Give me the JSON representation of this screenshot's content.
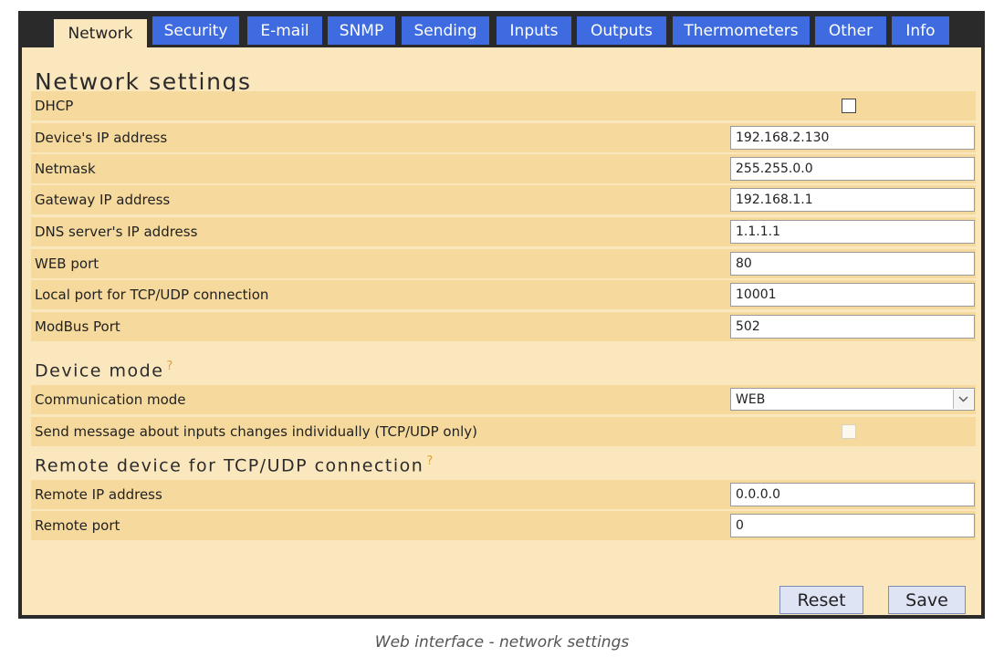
{
  "tabs": [
    "Network",
    "Security",
    "E-mail",
    "SNMP",
    "Sending",
    "Inputs",
    "Outputs",
    "Thermometers",
    "Other",
    "Info"
  ],
  "title": "Network settings",
  "network": {
    "dhcp_label": "DHCP",
    "dhcp_checked": false,
    "ip_label": "Device's IP address",
    "ip_value": "192.168.2.130",
    "netmask_label": "Netmask",
    "netmask_value": "255.255.0.0",
    "gateway_label": "Gateway IP address",
    "gateway_value": "192.168.1.1",
    "dns_label": "DNS server's IP address",
    "dns_value": "1.1.1.1",
    "web_port_label": "WEB port",
    "web_port_value": "80",
    "local_port_label": "Local port for TCP/UDP connection",
    "local_port_value": "10001",
    "modbus_label": "ModBus Port",
    "modbus_value": "502"
  },
  "device_mode": {
    "heading": "Device mode",
    "help": "?",
    "comm_label": "Communication mode",
    "comm_value": "WEB",
    "send_individually_label": "Send message about inputs changes individually (TCP/UDP only)",
    "send_individually_checked": false
  },
  "remote": {
    "heading": "Remote device for TCP/UDP connection",
    "help": "?",
    "ip_label": "Remote IP address",
    "ip_value": "0.0.0.0",
    "port_label": "Remote port",
    "port_value": "0"
  },
  "buttons": {
    "reset": "Reset",
    "save": "Save"
  },
  "caption": "Web interface - network settings",
  "colors": {
    "tab_blue": "#3f6be0",
    "panel_bg": "#fbe7bd",
    "row_bg": "#f6d99c",
    "frame": "#2a2a2a",
    "help_accent": "#e0a038"
  }
}
